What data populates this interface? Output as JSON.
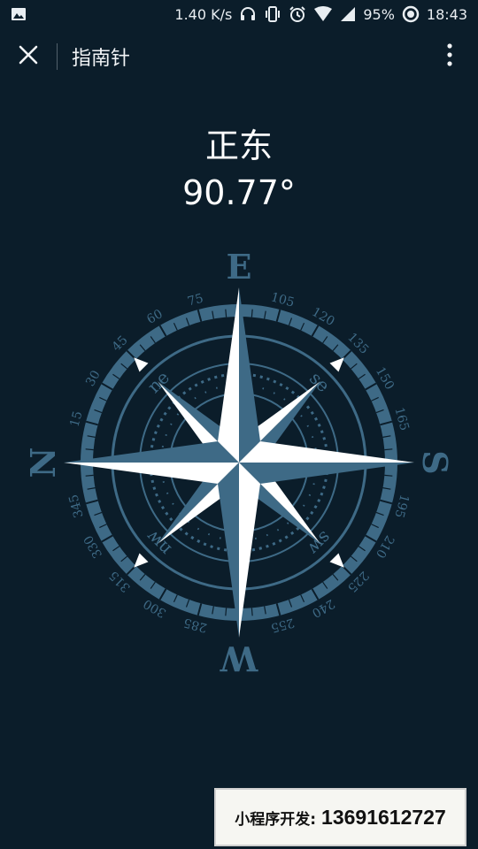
{
  "status_bar": {
    "gallery_icon": "image-icon",
    "net_speed": "1.40 K/s",
    "battery": "95%",
    "time": "18:43"
  },
  "title_bar": {
    "close_icon": "close-icon",
    "title": "指南针",
    "more_icon": "more-vertical-icon"
  },
  "heading": {
    "direction": "正东",
    "degrees": "90.77°"
  },
  "compass": {
    "cardinals": {
      "E": "E",
      "S": "S",
      "W": "W",
      "N": "N"
    },
    "intercardinals": {
      "ne": "ne",
      "se": "se",
      "sw": "sw",
      "nw": "nw"
    },
    "tick_labels": [
      "105",
      "120",
      "135",
      "150",
      "165",
      "195",
      "210",
      "225",
      "240",
      "255",
      "285",
      "300",
      "315",
      "330",
      "345",
      "15",
      "30",
      "45",
      "60",
      "75"
    ],
    "colors": {
      "primary": "#3e6a86",
      "light": "#ffffff",
      "dark_bg": "#0b1d2a"
    }
  },
  "promo": {
    "label": "小程序开发:",
    "phone": "13691612727"
  }
}
